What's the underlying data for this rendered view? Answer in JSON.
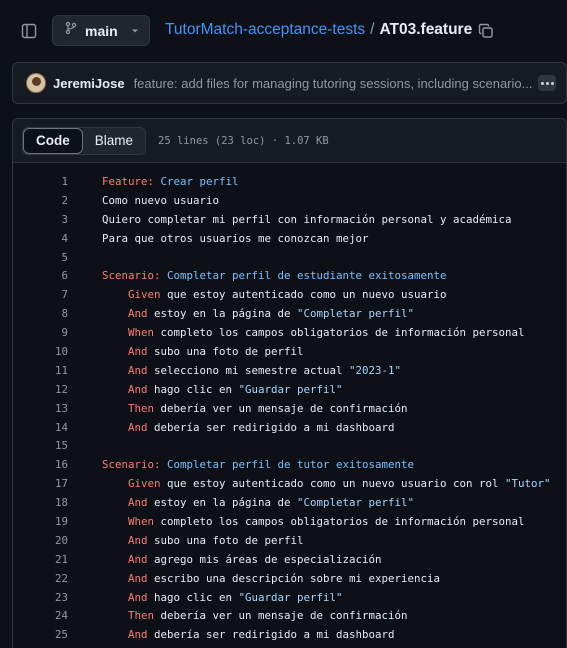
{
  "header": {
    "branch": "main",
    "repo": "TutorMatch-acceptance-tests",
    "separator": "/",
    "file": "AT03.feature"
  },
  "commit": {
    "author": "JeremiJose",
    "message": "feature: add files for managing tutoring sessions, including scenario..."
  },
  "file": {
    "tab_code": "Code",
    "tab_blame": "Blame",
    "meta": "25 lines (23 loc) · 1.07 KB"
  },
  "lines": [
    {
      "n": "1",
      "indent": "",
      "segs": [
        [
          "kw",
          "Feature:"
        ],
        [
          "title",
          " Crear perfil"
        ]
      ]
    },
    {
      "n": "2",
      "indent": "",
      "segs": [
        [
          "",
          "Como nuevo usuario"
        ]
      ]
    },
    {
      "n": "3",
      "indent": "",
      "segs": [
        [
          "",
          "Quiero completar mi perfil con información personal y académica"
        ]
      ]
    },
    {
      "n": "4",
      "indent": "",
      "segs": [
        [
          "",
          "Para que otros usuarios me conozcan mejor"
        ]
      ]
    },
    {
      "n": "5",
      "indent": "",
      "segs": []
    },
    {
      "n": "6",
      "indent": "",
      "segs": [
        [
          "kw",
          "Scenario:"
        ],
        [
          "title",
          " Completar perfil de estudiante exitosamente"
        ]
      ]
    },
    {
      "n": "7",
      "indent": "    ",
      "segs": [
        [
          "kw",
          "Given"
        ],
        [
          "",
          " que estoy autenticado como un nuevo usuario"
        ]
      ]
    },
    {
      "n": "8",
      "indent": "    ",
      "segs": [
        [
          "kw",
          "And"
        ],
        [
          "",
          " estoy en la página de "
        ],
        [
          "str",
          "\"Completar perfil\""
        ]
      ]
    },
    {
      "n": "9",
      "indent": "    ",
      "segs": [
        [
          "kw",
          "When"
        ],
        [
          "",
          " completo los campos obligatorios de información personal"
        ]
      ]
    },
    {
      "n": "10",
      "indent": "    ",
      "segs": [
        [
          "kw",
          "And"
        ],
        [
          "",
          " subo una foto de perfil"
        ]
      ]
    },
    {
      "n": "11",
      "indent": "    ",
      "segs": [
        [
          "kw",
          "And"
        ],
        [
          "",
          " selecciono mi semestre actual "
        ],
        [
          "str",
          "\"2023-1\""
        ]
      ]
    },
    {
      "n": "12",
      "indent": "    ",
      "segs": [
        [
          "kw",
          "And"
        ],
        [
          "",
          " hago clic en "
        ],
        [
          "str",
          "\"Guardar perfil\""
        ]
      ]
    },
    {
      "n": "13",
      "indent": "    ",
      "segs": [
        [
          "kw",
          "Then"
        ],
        [
          "",
          " debería ver un mensaje de confirmación"
        ]
      ]
    },
    {
      "n": "14",
      "indent": "    ",
      "segs": [
        [
          "kw",
          "And"
        ],
        [
          "",
          " debería ser redirigido a mi dashboard"
        ]
      ]
    },
    {
      "n": "15",
      "indent": "",
      "segs": []
    },
    {
      "n": "16",
      "indent": "",
      "segs": [
        [
          "kw",
          "Scenario:"
        ],
        [
          "title",
          " Completar perfil de tutor exitosamente"
        ]
      ]
    },
    {
      "n": "17",
      "indent": "    ",
      "segs": [
        [
          "kw",
          "Given"
        ],
        [
          "",
          " que estoy autenticado como un nuevo usuario con rol "
        ],
        [
          "str",
          "\"Tutor\""
        ]
      ]
    },
    {
      "n": "18",
      "indent": "    ",
      "segs": [
        [
          "kw",
          "And"
        ],
        [
          "",
          " estoy en la página de "
        ],
        [
          "str",
          "\"Completar perfil\""
        ]
      ]
    },
    {
      "n": "19",
      "indent": "    ",
      "segs": [
        [
          "kw",
          "When"
        ],
        [
          "",
          " completo los campos obligatorios de información personal"
        ]
      ]
    },
    {
      "n": "20",
      "indent": "    ",
      "segs": [
        [
          "kw",
          "And"
        ],
        [
          "",
          " subo una foto de perfil"
        ]
      ]
    },
    {
      "n": "21",
      "indent": "    ",
      "segs": [
        [
          "kw",
          "And"
        ],
        [
          "",
          " agrego mis áreas de especialización"
        ]
      ]
    },
    {
      "n": "22",
      "indent": "    ",
      "segs": [
        [
          "kw",
          "And"
        ],
        [
          "",
          " escribo una descripción sobre mi experiencia"
        ]
      ]
    },
    {
      "n": "23",
      "indent": "    ",
      "segs": [
        [
          "kw",
          "And"
        ],
        [
          "",
          " hago clic en "
        ],
        [
          "str",
          "\"Guardar perfil\""
        ]
      ]
    },
    {
      "n": "24",
      "indent": "    ",
      "segs": [
        [
          "kw",
          "Then"
        ],
        [
          "",
          " debería ver un mensaje de confirmación"
        ]
      ]
    },
    {
      "n": "25",
      "indent": "    ",
      "segs": [
        [
          "kw",
          "And"
        ],
        [
          "",
          " debería ser redirigido a mi dashboard"
        ]
      ]
    }
  ]
}
